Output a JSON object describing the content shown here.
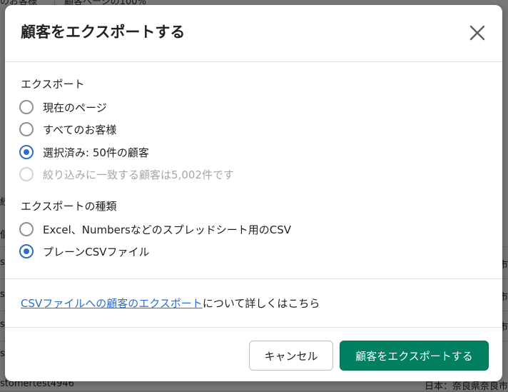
{
  "background": {
    "top_items": [
      "のお客様",
      "顧客ページの100%"
    ],
    "left_fragments": [
      "絞",
      "個",
      "s",
      "s",
      "s",
      "s",
      "stomertest4946"
    ],
    "right_fragments": [
      "市",
      "市",
      "市",
      "日本：奈良県奈良市"
    ]
  },
  "modal": {
    "title": "顧客をエクスポートする",
    "export_section": {
      "label": "エクスポート",
      "options": [
        {
          "label": "現在のページ",
          "checked": false,
          "disabled": false
        },
        {
          "label": "すべてのお客様",
          "checked": false,
          "disabled": false
        },
        {
          "label": "選択済み: 50件の顧客",
          "checked": true,
          "disabled": false
        },
        {
          "label": "絞り込みに一致する顧客は5,002件です",
          "checked": false,
          "disabled": true
        }
      ]
    },
    "format_section": {
      "label": "エクスポートの種類",
      "options": [
        {
          "label": "Excel、Numbersなどのスプレッドシート用のCSV",
          "checked": false
        },
        {
          "label": "プレーンCSVファイル",
          "checked": true
        }
      ]
    },
    "help": {
      "link_text": "CSVファイルへの顧客のエクスポート",
      "suffix": "について詳しくはこちら"
    },
    "buttons": {
      "cancel": "キャンセル",
      "export": "顧客をエクスポートする"
    }
  },
  "colors": {
    "accent": "#2c6ecb",
    "primary_button": "#008060"
  }
}
